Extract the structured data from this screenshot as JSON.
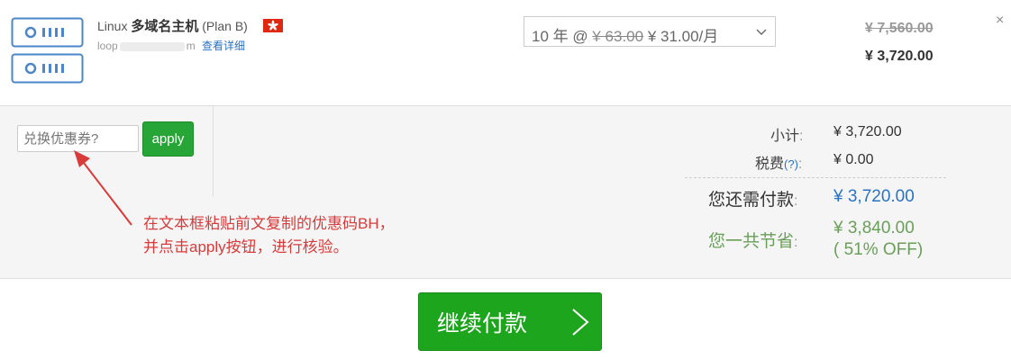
{
  "product": {
    "os": "Linux",
    "name": "多域名主机",
    "plan": "(Plan B)",
    "flag": "hong-kong-flag",
    "domain_prefix": "loop",
    "domain_suffix": "m",
    "detail_link": "查看详细"
  },
  "billing_cycle": {
    "period": "10 年 @",
    "old_price": "¥ 63.00",
    "new_price": "¥ 31.00/月"
  },
  "prices": {
    "original": "¥ 7,560.00",
    "current": "¥ 3,720.00"
  },
  "close_label": "×",
  "coupon": {
    "placeholder": "兑换优惠券?",
    "apply_label": "apply"
  },
  "annotation": {
    "line1": "在文本框粘贴前文复制的优惠码BH，",
    "line2": "并点击apply按钮，进行核验。"
  },
  "summary": {
    "subtotal_label": "小计",
    "subtotal_value": "¥ 3,720.00",
    "tax_label": "税费",
    "tax_help": "(?)",
    "tax_value": "¥ 0.00",
    "due_label": "您还需付款",
    "due_value": "¥ 3,720.00",
    "saved_label": "您一共节省",
    "saved_value": "¥ 3,840.00",
    "saved_percent": "( 51% OFF)",
    "colon": ":"
  },
  "checkout": {
    "label": "继续付款"
  },
  "colors": {
    "apply_green": "#27a536",
    "checkout_green": "#1ea51e",
    "link_blue": "#2a72c4",
    "annotation_red": "#d93a3a",
    "save_green": "#6a9f5a"
  }
}
